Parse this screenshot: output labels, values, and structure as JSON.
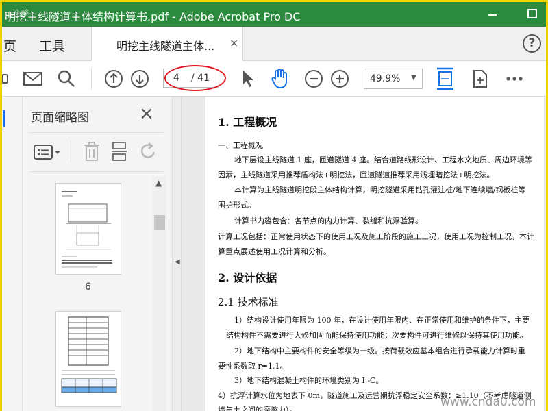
{
  "window": {
    "title": "明挖主线隧道主体结构计算书.pdf - Adobe Acrobat Pro DC",
    "watermark_top": "沧峰"
  },
  "tabs": {
    "home": "页",
    "tools": "工具",
    "document": "明挖主线隧道主体...",
    "close": "×",
    "help": "?"
  },
  "toolbar": {
    "page_current": "4",
    "page_total": "/ 41",
    "zoom": "49.9%"
  },
  "sidebar": {
    "title": "页面缩略图",
    "close": "×",
    "thumbnails": [
      {
        "label": "6"
      },
      {
        "label": ""
      }
    ]
  },
  "document": {
    "lines": [
      {
        "text": "1. 工程概况",
        "style": "h1"
      },
      {
        "text": "一、工程概况",
        "style": "p"
      },
      {
        "text": "地下层设主线隧道 1 座，匝道隧道 4 座。结合道路线形设计、工程水文地质、周边环境等",
        "style": "p"
      },
      {
        "text": "因素，主线隧道采用推荐盾构法+明挖法，匝道隧道推荐采用浅埋暗挖法+明挖法。",
        "style": "p"
      },
      {
        "text": "本计算为主线隧道明挖段主体结构计算，明挖隧道采用钻孔灌注桩/地下连续墙/钢板桩等",
        "style": "p"
      },
      {
        "text": "围护形式。",
        "style": "p"
      },
      {
        "text": "计算书内容包含：各节点的内力计算、裂缝和抗浮验算。",
        "style": "p"
      },
      {
        "text": "计算工况包括：正常使用状态下的使用工况及施工阶段的施工工况，使用工况为控制工况，本计",
        "style": "p"
      },
      {
        "text": "算重点展述使用工况计算和分析。",
        "style": "p"
      },
      {
        "text": "2. 设计依据",
        "style": "h1"
      },
      {
        "text": "2.1   技术标准",
        "style": "h2"
      },
      {
        "text": "1）结构设计使用年限为 100 年，在设计使用年限内、在正常使用和维护的条件下，主要",
        "style": "p"
      },
      {
        "text": "结构构件不需要进行大修加固而能保持使用功能；次要构件可进行维修以保持其使用功能。",
        "style": "p"
      },
      {
        "text": "2）地下结构中主要构件的安全等级为一级。按荷载效应基本组合进行承载能力计算时重",
        "style": "p"
      },
      {
        "text": "要性系数取 r=1.1。",
        "style": "p"
      },
      {
        "text": "3）地下结构混凝土构件的环境类别为 I -C。",
        "style": "p"
      },
      {
        "text": "4）抗浮计算水位为地表下  0m，隧道施工及运营期抗浮稳定安全系数：≥1.10（不考虑隧道侧",
        "style": "p"
      },
      {
        "text": "墙与土之间的摩擦力）。",
        "style": "p"
      }
    ]
  },
  "footer_watermark": "www.cnda0.com",
  "colors": {
    "titlebar": "#2b8a3e",
    "accent": "#1473e6",
    "annotation": "#e0141e",
    "frame": "#f2d200"
  }
}
